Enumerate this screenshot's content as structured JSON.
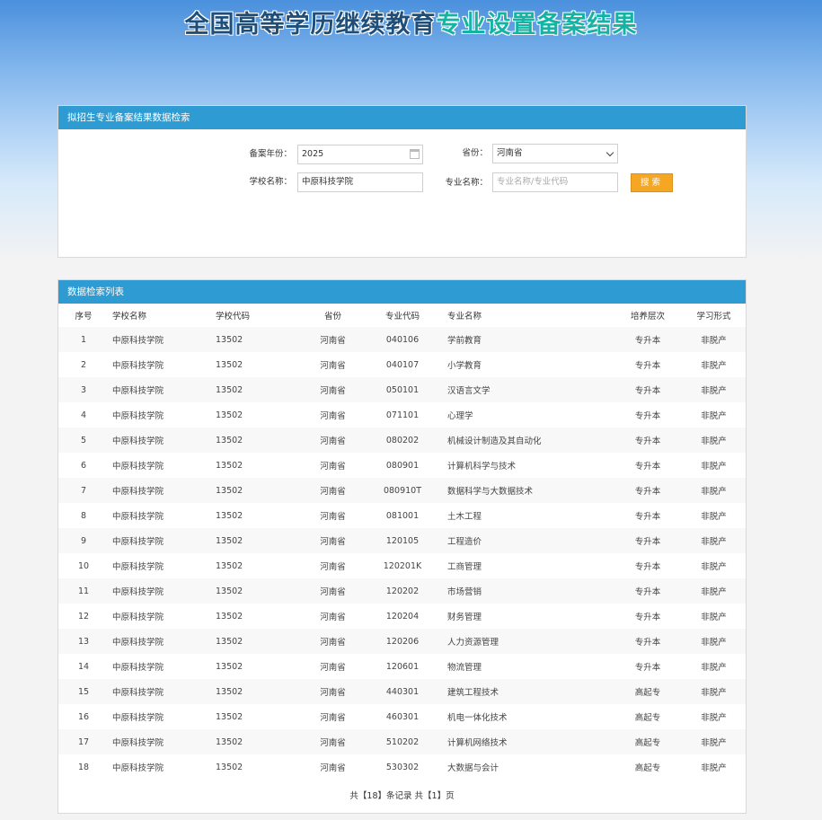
{
  "header": {
    "title_part1": "全国高等学历继续教育",
    "title_part2": "专业设置备案结果"
  },
  "search": {
    "panel_title": "拟招生专业备案结果数据检索",
    "year_label": "备案年份：",
    "year_value": "2025",
    "province_label": "省份：",
    "province_value": "河南省",
    "school_label": "学校名称：",
    "school_value": "中原科技学院",
    "major_label": "专业名称：",
    "major_placeholder": "专业名称/专业代码",
    "search_button": "搜索"
  },
  "results": {
    "panel_title": "数据检索列表",
    "columns": [
      "序号",
      "学校名称",
      "学校代码",
      "省份",
      "专业代码",
      "专业名称",
      "培养层次",
      "学习形式"
    ],
    "rows": [
      [
        "1",
        "中原科技学院",
        "13502",
        "河南省",
        "040106",
        "学前教育",
        "专升本",
        "非脱产"
      ],
      [
        "2",
        "中原科技学院",
        "13502",
        "河南省",
        "040107",
        "小学教育",
        "专升本",
        "非脱产"
      ],
      [
        "3",
        "中原科技学院",
        "13502",
        "河南省",
        "050101",
        "汉语言文学",
        "专升本",
        "非脱产"
      ],
      [
        "4",
        "中原科技学院",
        "13502",
        "河南省",
        "071101",
        "心理学",
        "专升本",
        "非脱产"
      ],
      [
        "5",
        "中原科技学院",
        "13502",
        "河南省",
        "080202",
        "机械设计制造及其自动化",
        "专升本",
        "非脱产"
      ],
      [
        "6",
        "中原科技学院",
        "13502",
        "河南省",
        "080901",
        "计算机科学与技术",
        "专升本",
        "非脱产"
      ],
      [
        "7",
        "中原科技学院",
        "13502",
        "河南省",
        "080910T",
        "数据科学与大数据技术",
        "专升本",
        "非脱产"
      ],
      [
        "8",
        "中原科技学院",
        "13502",
        "河南省",
        "081001",
        "土木工程",
        "专升本",
        "非脱产"
      ],
      [
        "9",
        "中原科技学院",
        "13502",
        "河南省",
        "120105",
        "工程造价",
        "专升本",
        "非脱产"
      ],
      [
        "10",
        "中原科技学院",
        "13502",
        "河南省",
        "120201K",
        "工商管理",
        "专升本",
        "非脱产"
      ],
      [
        "11",
        "中原科技学院",
        "13502",
        "河南省",
        "120202",
        "市场营销",
        "专升本",
        "非脱产"
      ],
      [
        "12",
        "中原科技学院",
        "13502",
        "河南省",
        "120204",
        "财务管理",
        "专升本",
        "非脱产"
      ],
      [
        "13",
        "中原科技学院",
        "13502",
        "河南省",
        "120206",
        "人力资源管理",
        "专升本",
        "非脱产"
      ],
      [
        "14",
        "中原科技学院",
        "13502",
        "河南省",
        "120601",
        "物流管理",
        "专升本",
        "非脱产"
      ],
      [
        "15",
        "中原科技学院",
        "13502",
        "河南省",
        "440301",
        "建筑工程技术",
        "高起专",
        "非脱产"
      ],
      [
        "16",
        "中原科技学院",
        "13502",
        "河南省",
        "460301",
        "机电一体化技术",
        "高起专",
        "非脱产"
      ],
      [
        "17",
        "中原科技学院",
        "13502",
        "河南省",
        "510202",
        "计算机网络技术",
        "高起专",
        "非脱产"
      ],
      [
        "18",
        "中原科技学院",
        "13502",
        "河南省",
        "530302",
        "大数据与会计",
        "高起专",
        "非脱产"
      ]
    ],
    "pager": "共【18】条记录 共【1】页"
  },
  "icons": {
    "date_picker": "calendar-icon",
    "province_select": "chevron-down-icon"
  },
  "colors": {
    "panel_header": "#2e9bd2",
    "search_button": "#f5a623",
    "title_dark": "#1f4e79",
    "title_accent": "#15b3a3"
  }
}
